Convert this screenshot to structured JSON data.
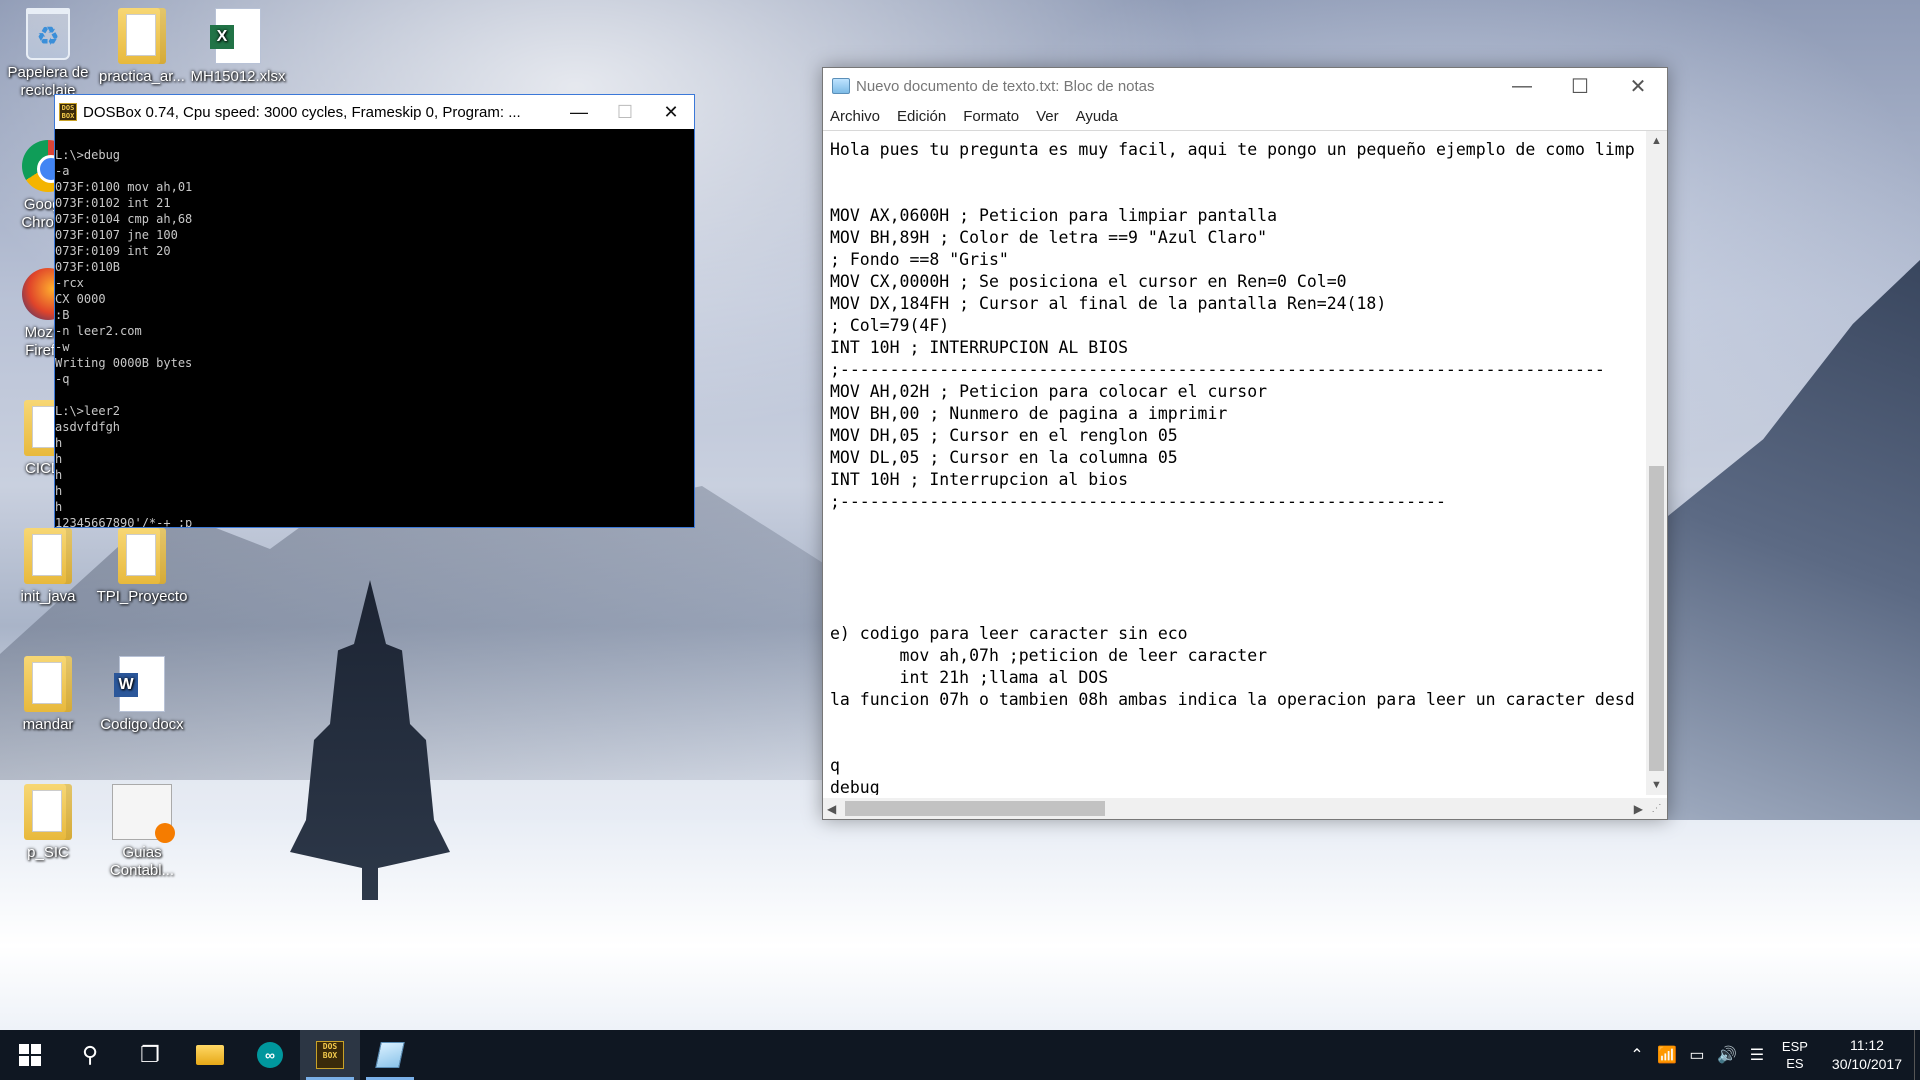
{
  "desktop": {
    "icons": [
      {
        "label": "Papelera de reciclaje",
        "icon": "recycle-bin-icon"
      },
      {
        "label": "practica_ar...",
        "icon": "folder-icon"
      },
      {
        "label": "MH15012.xlsx",
        "icon": "excel-file-icon"
      },
      {
        "label": "Google Chrome",
        "icon": "chrome-icon"
      },
      {
        "label": "Mozilla Firefox",
        "icon": "firefox-icon"
      },
      {
        "label": "CICLO",
        "icon": "folder-icon"
      },
      {
        "label": "init_java",
        "icon": "folder-icon"
      },
      {
        "label": "TPI_Proyecto",
        "icon": "folder-icon"
      },
      {
        "label": "mandar",
        "icon": "folder-icon"
      },
      {
        "label": "Codigo.docx",
        "icon": "word-file-icon"
      },
      {
        "label": "p_SIC",
        "icon": "folder-icon"
      },
      {
        "label": "Guias Contabl...",
        "icon": "pdf-doc-icon"
      }
    ]
  },
  "dosbox": {
    "title": "DOSBox 0.74, Cpu speed:     3000 cycles, Frameskip  0, Program: ...",
    "screen": "L:\\>debug\n-a\n073F:0100 mov ah,01\n073F:0102 int 21\n073F:0104 cmp ah,68\n073F:0107 jne 100\n073F:0109 int 20\n073F:010B\n-rcx\nCX 0000\n:B\n-n leer2.com\n-w\nWriting 0000B bytes\n-q\n\nL:\\>leer2\nasdvfdfgh\nh\nh\nh\nh\nh\n12345667890'/*-+ ;p"
  },
  "notepad": {
    "title": "Nuevo documento de texto.txt: Bloc de notas",
    "menu": [
      "Archivo",
      "Edición",
      "Formato",
      "Ver",
      "Ayuda"
    ],
    "text": "Hola pues tu pregunta es muy facil, aqui te pongo un pequeño ejemplo de como limp\n\n\nMOV AX,0600H ; Peticion para limpiar pantalla\nMOV BH,89H ; Color de letra ==9 \"Azul Claro\"\n; Fondo ==8 \"Gris\"\nMOV CX,0000H ; Se posiciona el cursor en Ren=0 Col=0\nMOV DX,184FH ; Cursor al final de la pantalla Ren=24(18)\n; Col=79(4F)\nINT 10H ; INTERRUPCION AL BIOS\n;-----------------------------------------------------------------------------\nMOV AH,02H ; Peticion para colocar el cursor\nMOV BH,00 ; Nunmero de pagina a imprimir\nMOV DH,05 ; Cursor en el renglon 05\nMOV DL,05 ; Cursor en la columna 05\nINT 10H ; Interrupcion al bios\n;-------------------------------------------------------------\n\n\n\n\n\ne) codigo para leer caracter sin eco\n       mov ah,07h ;peticion de leer caracter\n       int 21h ;llama al DOS\nla funcion 07h o tambien 08h ambas indica la operacion para leer un caracter desd\n\n\nq\ndebug"
  },
  "taskbar": {
    "apps": [
      "start-button",
      "search",
      "task-view",
      "file-explorer",
      "arduino",
      "dosbox",
      "notepad"
    ],
    "tray": {
      "lang_top": "ESP",
      "lang_bottom": "ES",
      "time": "11:12",
      "date": "30/10/2017"
    }
  }
}
